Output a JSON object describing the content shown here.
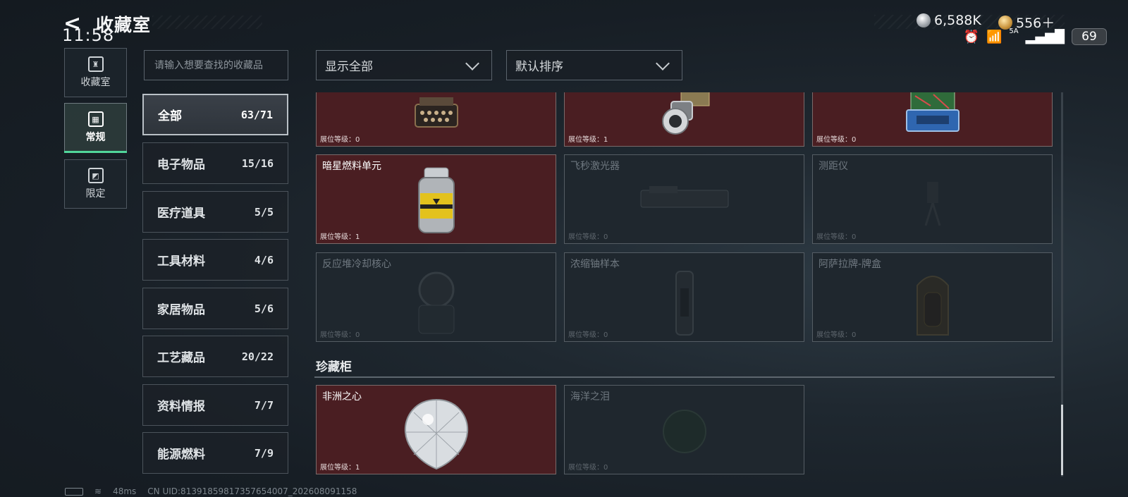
{
  "status_bar": {
    "time": "11:58",
    "network": "5A",
    "battery": "69"
  },
  "header": {
    "back_icon": "back-arrow-icon",
    "title": "收藏室"
  },
  "currency": [
    {
      "icon": "silver-coin-icon",
      "value": "6,588K"
    },
    {
      "icon": "gold-coin-icon",
      "value": "556＋"
    }
  ],
  "nav": [
    {
      "label": "收藏室",
      "icon": "trophy-icon",
      "active": false
    },
    {
      "label": "常规",
      "icon": "card-icon",
      "active": true
    },
    {
      "label": "限定",
      "icon": "limited-icon",
      "active": false
    }
  ],
  "search": {
    "placeholder": "请输入想要查找的收藏品"
  },
  "filters": {
    "show": "显示全部",
    "sort": "默认排序"
  },
  "categories": [
    {
      "label": "全部",
      "count": "63/71",
      "active": true
    },
    {
      "label": "电子物品",
      "count": "15/16"
    },
    {
      "label": "医疗道具",
      "count": "5/5"
    },
    {
      "label": "工具材料",
      "count": "4/6"
    },
    {
      "label": "家居物品",
      "count": "5/6"
    },
    {
      "label": "工艺藏品",
      "count": "20/22"
    },
    {
      "label": "资料情报",
      "count": "7/7"
    },
    {
      "label": "能源燃料",
      "count": "7/9"
    }
  ],
  "cards_top": [
    {
      "name": "",
      "level": "展位等级：0",
      "owned": true,
      "art": "typewriter"
    },
    {
      "name": "",
      "level": "展位等级：1",
      "owned": true,
      "art": "lens"
    },
    {
      "name": "",
      "level": "展位等级：0",
      "owned": true,
      "art": "circuit"
    }
  ],
  "cards_mid": [
    {
      "name": "暗星燃料单元",
      "level": "展位等级：1",
      "owned": true,
      "art": "fuel-canister"
    },
    {
      "name": "飞秒激光器",
      "level": "展位等级：0",
      "owned": false,
      "art": "laser"
    },
    {
      "name": "测距仪",
      "level": "展位等级：0",
      "owned": false,
      "art": "rangefinder"
    }
  ],
  "cards_low": [
    {
      "name": "反应堆冷却核心",
      "level": "展位等级：0",
      "owned": false,
      "art": "reactor-core"
    },
    {
      "name": "浓缩铀样本",
      "level": "展位等级：0",
      "owned": false,
      "art": "uranium"
    },
    {
      "name": "阿萨拉牌-牌盒",
      "level": "展位等级：0",
      "owned": false,
      "art": "card-box"
    }
  ],
  "treasure": {
    "title": "珍藏柜",
    "cards": [
      {
        "name": "非洲之心",
        "level": "展位等级：1",
        "owned": true,
        "art": "diamond"
      },
      {
        "name": "海洋之泪",
        "level": "展位等级：0",
        "owned": false,
        "art": "gem"
      }
    ]
  },
  "footer": {
    "ping": "48ms",
    "uid": "CN UID:8139185981735765400​7_202608091158"
  },
  "colors": {
    "owned_card": "#4a1e22",
    "active_tab_underline": "#51d59a"
  }
}
